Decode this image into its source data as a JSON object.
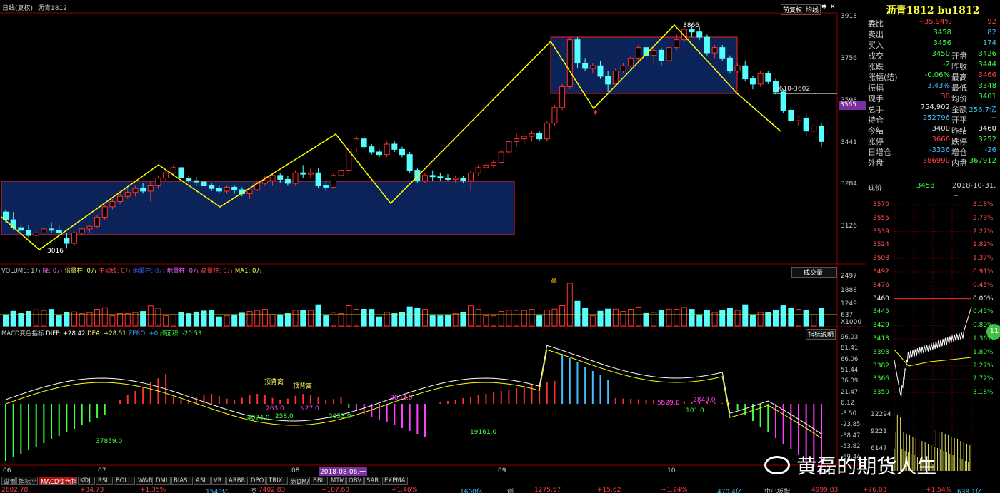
{
  "header": {
    "left_label": "日线(复权)",
    "symbol": "沥青1812",
    "btn_fuquan": "前复权",
    "btn_style": "均线",
    "y_top": "3913"
  },
  "main_y_labels": [
    "3913",
    "3756",
    "3598",
    "3441",
    "3284",
    "3126"
  ],
  "price_markers": {
    "current": "3565",
    "range_note": "3610-3602",
    "high_note": "3866",
    "low_note": "3016"
  },
  "chart_data": {
    "type": "candlestick",
    "period": "daily",
    "symbol": "沥青1812",
    "x_month_ticks": [
      "06",
      "07",
      "08",
      "09",
      "10"
    ],
    "y_ticks": [
      3913,
      3756,
      3598,
      3441,
      3284,
      3126
    ],
    "annotations": [
      "3866",
      "3016",
      "3610-3602"
    ],
    "ohlc": [
      [
        3150,
        3160,
        3110,
        3120
      ],
      [
        3120,
        3150,
        3080,
        3090
      ],
      [
        3090,
        3110,
        3070,
        3080
      ],
      [
        3080,
        3100,
        3050,
        3060
      ],
      [
        3060,
        3085,
        3030,
        3070
      ],
      [
        3070,
        3090,
        3050,
        3085
      ],
      [
        3085,
        3110,
        3070,
        3080
      ],
      [
        3080,
        3100,
        3060,
        3070
      ],
      [
        3050,
        3070,
        3010,
        3030
      ],
      [
        3030,
        3075,
        3020,
        3070
      ],
      [
        3070,
        3090,
        3060,
        3085
      ],
      [
        3085,
        3100,
        3070,
        3095
      ],
      [
        3095,
        3140,
        3090,
        3130
      ],
      [
        3130,
        3175,
        3120,
        3170
      ],
      [
        3170,
        3200,
        3160,
        3190
      ],
      [
        3190,
        3230,
        3180,
        3210
      ],
      [
        3210,
        3240,
        3200,
        3225
      ],
      [
        3225,
        3250,
        3210,
        3240
      ],
      [
        3240,
        3260,
        3220,
        3230
      ],
      [
        3230,
        3270,
        3190,
        3250
      ],
      [
        3250,
        3290,
        3240,
        3280
      ],
      [
        3280,
        3310,
        3270,
        3300
      ],
      [
        3300,
        3330,
        3290,
        3320
      ],
      [
        3320,
        3320,
        3270,
        3280
      ],
      [
        3280,
        3290,
        3260,
        3270
      ],
      [
        3270,
        3285,
        3250,
        3265
      ],
      [
        3265,
        3275,
        3240,
        3250
      ],
      [
        3250,
        3260,
        3230,
        3240
      ],
      [
        3240,
        3250,
        3220,
        3230
      ],
      [
        3230,
        3250,
        3220,
        3245
      ],
      [
        3245,
        3250,
        3220,
        3235
      ],
      [
        3235,
        3245,
        3210,
        3220
      ],
      [
        3220,
        3240,
        3200,
        3235
      ],
      [
        3235,
        3270,
        3230,
        3260
      ],
      [
        3260,
        3290,
        3250,
        3270
      ],
      [
        3270,
        3300,
        3250,
        3290
      ],
      [
        3290,
        3300,
        3260,
        3275
      ],
      [
        3275,
        3290,
        3250,
        3260
      ],
      [
        3260,
        3310,
        3250,
        3300
      ],
      [
        3300,
        3330,
        3280,
        3295
      ],
      [
        3295,
        3320,
        3280,
        3300
      ],
      [
        3300,
        3320,
        3240,
        3250
      ],
      [
        3250,
        3270,
        3230,
        3245
      ],
      [
        3245,
        3300,
        3240,
        3290
      ],
      [
        3290,
        3320,
        3280,
        3310
      ],
      [
        3310,
        3400,
        3300,
        3395
      ],
      [
        3395,
        3440,
        3380,
        3430
      ],
      [
        3430,
        3440,
        3390,
        3400
      ],
      [
        3400,
        3410,
        3370,
        3380
      ],
      [
        3380,
        3390,
        3360,
        3370
      ],
      [
        3370,
        3420,
        3360,
        3410
      ],
      [
        3410,
        3420,
        3380,
        3390
      ],
      [
        3390,
        3400,
        3360,
        3370
      ],
      [
        3370,
        3380,
        3300,
        3310
      ],
      [
        3310,
        3320,
        3260,
        3270
      ],
      [
        3270,
        3300,
        3260,
        3290
      ],
      [
        3290,
        3310,
        3270,
        3285
      ],
      [
        3285,
        3300,
        3270,
        3280
      ],
      [
        3280,
        3295,
        3270,
        3275
      ],
      [
        3275,
        3290,
        3260,
        3280
      ],
      [
        3280,
        3290,
        3260,
        3270
      ],
      [
        3270,
        3310,
        3230,
        3300
      ],
      [
        3300,
        3330,
        3290,
        3320
      ],
      [
        3320,
        3340,
        3300,
        3330
      ],
      [
        3330,
        3350,
        3320,
        3340
      ],
      [
        3340,
        3390,
        3330,
        3380
      ],
      [
        3380,
        3430,
        3370,
        3420
      ],
      [
        3420,
        3450,
        3400,
        3430
      ],
      [
        3430,
        3450,
        3410,
        3440
      ],
      [
        3440,
        3460,
        3420,
        3450
      ],
      [
        3450,
        3460,
        3420,
        3430
      ],
      [
        3430,
        3500,
        3420,
        3490
      ],
      [
        3490,
        3560,
        3480,
        3550
      ],
      [
        3550,
        3640,
        3540,
        3630
      ],
      [
        3630,
        3820,
        3620,
        3810
      ],
      [
        3810,
        3820,
        3700,
        3720
      ],
      [
        3720,
        3740,
        3690,
        3700
      ],
      [
        3700,
        3720,
        3680,
        3710
      ],
      [
        3710,
        3730,
        3660,
        3670
      ],
      [
        3670,
        3690,
        3610,
        3640
      ],
      [
        3640,
        3700,
        3630,
        3690
      ],
      [
        3690,
        3720,
        3680,
        3710
      ],
      [
        3710,
        3750,
        3700,
        3740
      ],
      [
        3740,
        3790,
        3730,
        3780
      ],
      [
        3780,
        3790,
        3730,
        3750
      ],
      [
        3750,
        3780,
        3720,
        3770
      ],
      [
        3770,
        3780,
        3710,
        3730
      ],
      [
        3730,
        3790,
        3720,
        3780
      ],
      [
        3780,
        3830,
        3770,
        3810
      ],
      [
        3810,
        3866,
        3800,
        3850
      ],
      [
        3850,
        3860,
        3820,
        3840
      ],
      [
        3840,
        3860,
        3810,
        3820
      ],
      [
        3820,
        3830,
        3750,
        3760
      ],
      [
        3760,
        3790,
        3740,
        3780
      ],
      [
        3780,
        3790,
        3730,
        3740
      ],
      [
        3740,
        3750,
        3680,
        3690
      ],
      [
        3690,
        3720,
        3680,
        3710
      ],
      [
        3710,
        3730,
        3650,
        3660
      ],
      [
        3660,
        3670,
        3620,
        3640
      ],
      [
        3640,
        3690,
        3630,
        3680
      ],
      [
        3680,
        3690,
        3640,
        3650
      ],
      [
        3650,
        3660,
        3600,
        3610
      ],
      [
        3610,
        3620,
        3530,
        3540
      ],
      [
        3540,
        3550,
        3490,
        3500
      ],
      [
        3500,
        3520,
        3480,
        3510
      ],
      [
        3510,
        3530,
        3440,
        3460
      ],
      [
        3460,
        3490,
        3450,
        3480
      ],
      [
        3480,
        3490,
        3400,
        3420
      ]
    ],
    "volume_y_ticks": [
      "2497",
      "1888",
      "1249",
      "637",
      "X1000"
    ],
    "macd_y_ticks": [
      "96.03",
      "81.41",
      "66.06",
      "51.44",
      "36.09",
      "21.47",
      "6.12",
      "-8.50",
      "-23.85",
      "-38.47",
      "-53.82",
      "-69.44"
    ],
    "macd_notes": [
      "37859.0",
      "4074.0",
      "263.0",
      "258.0",
      "N27.0",
      "2053.0",
      "8632.0",
      "19161.0",
      "5529.0",
      "101.0",
      "2849.0"
    ]
  },
  "indicators": {
    "volume_bar": {
      "vol": "VOLUME: 1万",
      "jiang": "降: 0万",
      "beiliang": "倍量柱: 0万",
      "zhuli": "主动线: 0万",
      "jianliang": "缩量柱: 0万",
      "diliang": "地量柱: 0万",
      "gaoliang": "高量柱: 0万",
      "ma1": "MA1: 0万"
    },
    "volume_btn": "成交量",
    "macd_bar": {
      "name": "MACD变色指标",
      "diff": "DIFF: +28.42",
      "dea": "DEA: +28.51",
      "zero": "ZERO: +0",
      "area": "绿面积: -20.53"
    },
    "macd_btn": "指标说明",
    "note_gao": "高",
    "divergence_1": "顶背离",
    "divergence_2": "顶背离"
  },
  "quote": {
    "title": "沥青1812 bu1812",
    "rows": [
      {
        "k1": "委比",
        "v1": "+35.94%",
        "v2": "92",
        "c1": "#ff4040",
        "c2": "#ff4040"
      },
      {
        "k1": "卖出",
        "v1": "3458",
        "v2": "82",
        "c1": "#40ff40",
        "c2": "#40c0ff"
      },
      {
        "k1": "买入",
        "v1": "3456",
        "v2": "174",
        "c1": "#40ff40",
        "c2": "#40c0ff"
      }
    ],
    "rows2": [
      {
        "k1": "成交",
        "v1": "3450",
        "k2": "开盘",
        "v2": "3426",
        "c1": "#40ff40",
        "c2": "#40ff40"
      },
      {
        "k1": "涨跌",
        "v1": "-2",
        "k2": "昨收",
        "v2": "3444",
        "c1": "#40ff40",
        "c2": "#40ff40"
      },
      {
        "k1": "涨幅(结)",
        "v1": "-0.06%",
        "k2": "最高",
        "v2": "3466",
        "c1": "#40ff40",
        "c2": "#ff4040"
      },
      {
        "k1": "振幅",
        "v1": "3.43%",
        "k2": "最低",
        "v2": "3348",
        "c1": "#40c0ff",
        "c2": "#40ff40"
      },
      {
        "k1": "现手",
        "v1": "30",
        "k2": "均价",
        "v2": "3401",
        "c1": "#ff4040",
        "c2": "#40ff40"
      },
      {
        "k1": "总手",
        "v1": "754,902",
        "k2": "金额",
        "v2": "256.7亿",
        "c1": "#e0e0e0",
        "c2": "#40c0ff"
      },
      {
        "k1": "持仓",
        "v1": "252796",
        "k2": "开平",
        "v2": "--",
        "c1": "#40c0ff",
        "c2": "#e0e0e0"
      },
      {
        "k1": "今结",
        "v1": "3400",
        "k2": "昨结",
        "v2": "3460",
        "c1": "#e0e0e0",
        "c2": "#ffffff"
      },
      {
        "k1": "涨停",
        "v1": "3666",
        "k2": "跌停",
        "v2": "3252",
        "c1": "#ff4040",
        "c2": "#40ff40"
      },
      {
        "k1": "日增仓",
        "v1": "-3336",
        "k2": "增仓",
        "v2": "-26",
        "c1": "#40c0ff",
        "c2": "#40c0ff"
      },
      {
        "k1": "外盘",
        "v1": "386990",
        "k2": "内盘",
        "v2": "367912",
        "c1": "#ff4040",
        "c2": "#40ff40"
      }
    ],
    "now_label": "现价",
    "now_price": "3458",
    "now_date": "2018-10-31,三"
  },
  "intraday": {
    "left_ticks": [
      "3570",
      "3555",
      "3539",
      "3524",
      "3508",
      "3492",
      "3476",
      "3460",
      "3445",
      "3429",
      "3413",
      "3398",
      "3382",
      "3366",
      "3350"
    ],
    "right_ticks": [
      "3.18%",
      "2.73%",
      "2.27%",
      "1.82%",
      "1.37%",
      "0.91%",
      "0.45%",
      "0.00%",
      "0.45%",
      "0.89%",
      "1.36%",
      "1.80%",
      "2.27%",
      "2.72%",
      "3.18%"
    ],
    "vol_ticks": [
      "12294",
      "9221",
      "6147"
    ],
    "badge": "11"
  },
  "xaxis": {
    "m06": "06",
    "m07": "07",
    "m08": "08",
    "m09": "09",
    "m10": "10",
    "date_badge": "2018-08-06,一"
  },
  "tabs": [
    "设置",
    "指标平台",
    "MACD变色指标",
    "KDJ",
    "RSI",
    "BOLL",
    "W&R",
    "DMI",
    "BIAS",
    "ASI",
    "VR",
    "ARBR",
    "DPO",
    "TRIX",
    "新DMA",
    "BBI",
    "MTM",
    "OBV",
    "SAR",
    "EXPMA"
  ],
  "statusbar": [
    {
      "t": "2602.78",
      "c": "#ff4040"
    },
    {
      "t": "+34.73",
      "c": "#ff4040"
    },
    {
      "t": "+1.35%",
      "c": "#ff4040"
    },
    {
      "t": "1549亿",
      "c": "#40c0ff"
    },
    {
      "t": "深",
      "c": "#c0c0c0"
    },
    {
      "t": "7402.83",
      "c": "#ff4040"
    },
    {
      "t": "+107.60",
      "c": "#ff4040"
    },
    {
      "t": "+1.46%",
      "c": "#ff4040"
    },
    {
      "t": "1600亿",
      "c": "#40c0ff"
    },
    {
      "t": "创",
      "c": "#c0c0c0"
    },
    {
      "t": "1275.57",
      "c": "#ff4040"
    },
    {
      "t": "+15.62",
      "c": "#ff4040"
    },
    {
      "t": "+1.24%",
      "c": "#ff4040"
    },
    {
      "t": "470.4亿",
      "c": "#40c0ff"
    },
    {
      "t": "中小板指",
      "c": "#c0c0c0"
    },
    {
      "t": "4999.83",
      "c": "#ff4040"
    },
    {
      "t": "+76.03",
      "c": "#ff4040"
    },
    {
      "t": "+1.54%",
      "c": "#ff4040"
    },
    {
      "t": "638.1亿",
      "c": "#40c0ff"
    }
  ],
  "watermark": "黄磊的期货人生",
  "colors": {
    "up": "#ff3232",
    "down": "#54ffff",
    "ma": "#ffff00",
    "box": "#0b2358",
    "box_border": "#ff2020"
  }
}
